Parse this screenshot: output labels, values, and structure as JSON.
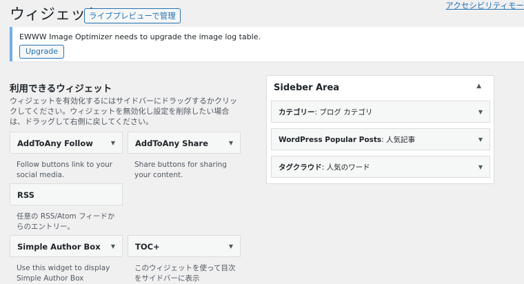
{
  "header": {
    "title": "ウィジェット",
    "live_preview_button": "ライブプレビューで管理",
    "accessibility_link": "アクセシビリティモー"
  },
  "notice": {
    "message": "EWWW Image Optimizer needs to upgrade the image log table.",
    "button": "Upgrade"
  },
  "available": {
    "title": "利用できるウィジェット",
    "description": "ウィジェットを有効化するにはサイドバーにドラッグするかクリックしてください。ウィジェットを無効化し設定を削除したい場合は、ドラッグして右側に戻してください。",
    "widgets": [
      {
        "title": "AddToAny Follow",
        "desc": "Follow buttons link to your social media."
      },
      {
        "title": "AddToAny Share",
        "desc": "Share buttons for sharing your content."
      },
      {
        "title": "RSS",
        "desc": "任意の RSS/Atom フィードからのエントリー。"
      },
      {
        "title": "Simple Author Box",
        "desc": "Use this widget to display Simple Author Box"
      },
      {
        "title": "TOC+",
        "desc": "このウィジェットを使って目次をサイドバーに表示"
      }
    ]
  },
  "sidebar": {
    "title": "Sideber Area",
    "widgets": [
      {
        "title": "カテゴリー",
        "subtitle": ": ブログ カテゴリ"
      },
      {
        "title": "WordPress Popular Posts",
        "subtitle": ": 人気記事"
      },
      {
        "title": "タグクラウド",
        "subtitle": ": 人気のワード"
      }
    ]
  },
  "icons": {
    "caret_down": "▼",
    "caret_up": "▲"
  }
}
